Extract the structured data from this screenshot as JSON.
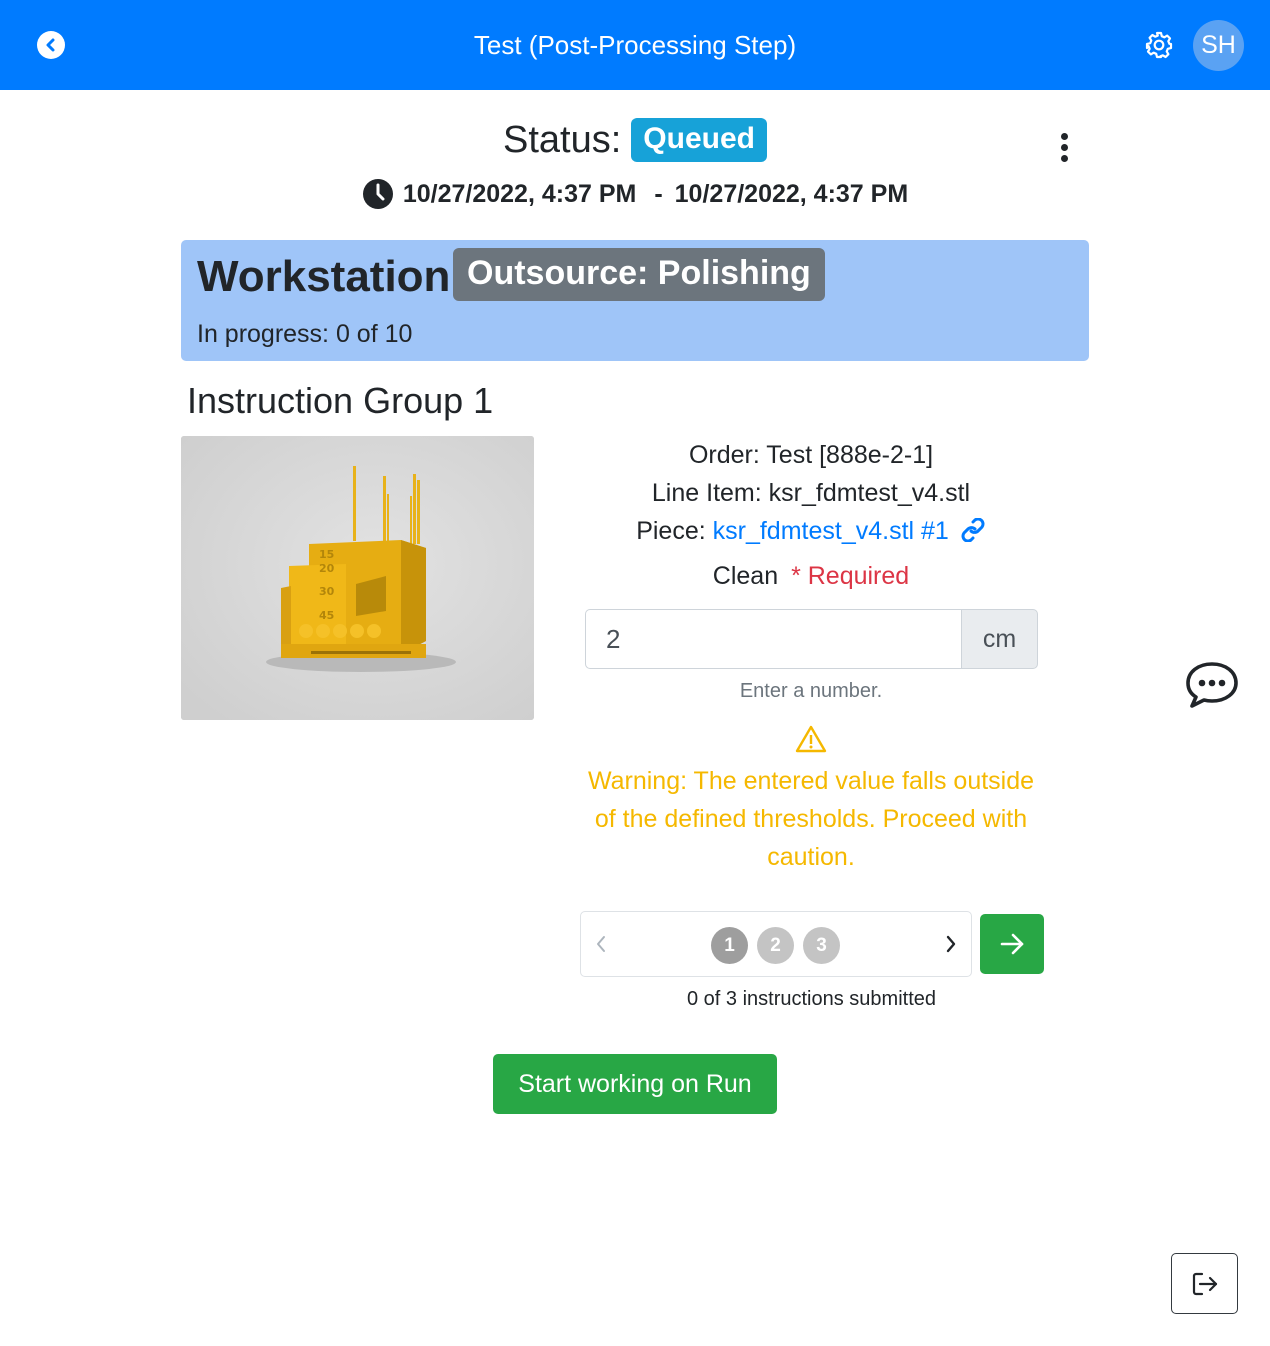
{
  "header": {
    "title": "Test (Post-Processing Step)",
    "avatar_initials": "SH",
    "brand_color": "#007bff",
    "icons": [
      "chevron-left-icon",
      "gear-icon"
    ]
  },
  "status": {
    "label": "Status:",
    "badge": "Queued",
    "badge_color": "#17a2d8",
    "start_time": "10/27/2022, 4:37 PM",
    "separator": "-",
    "end_time": "10/27/2022, 4:37 PM"
  },
  "workstation": {
    "label": "Workstation:",
    "badge": "Outsource: Polishing",
    "progress": "In progress: 0 of 10"
  },
  "instruction_group": {
    "title": "Instruction Group 1",
    "order_label": "Order:",
    "order_value": "Test [888e-2-1]",
    "line_item_label": "Line Item:",
    "line_item_value": "ksr_fdmtest_v4.stl",
    "piece_label": "Piece:",
    "piece_value": "ksr_fdmtest_v4.stl #1",
    "instruction_name": "Clean",
    "required_text": "* Required",
    "input_value": "2",
    "unit": "cm",
    "hint": "Enter a number.",
    "warning": "Warning: The entered value falls outside of the defined thresholds. Proceed with caution.",
    "warning_color": "#f5b800"
  },
  "pager": {
    "pages": [
      "1",
      "2",
      "3"
    ],
    "active_page": "1",
    "submitted": "0 of 3 instructions submitted"
  },
  "actions": {
    "start_label": "Start working on Run",
    "accent_green": "#28a745"
  }
}
